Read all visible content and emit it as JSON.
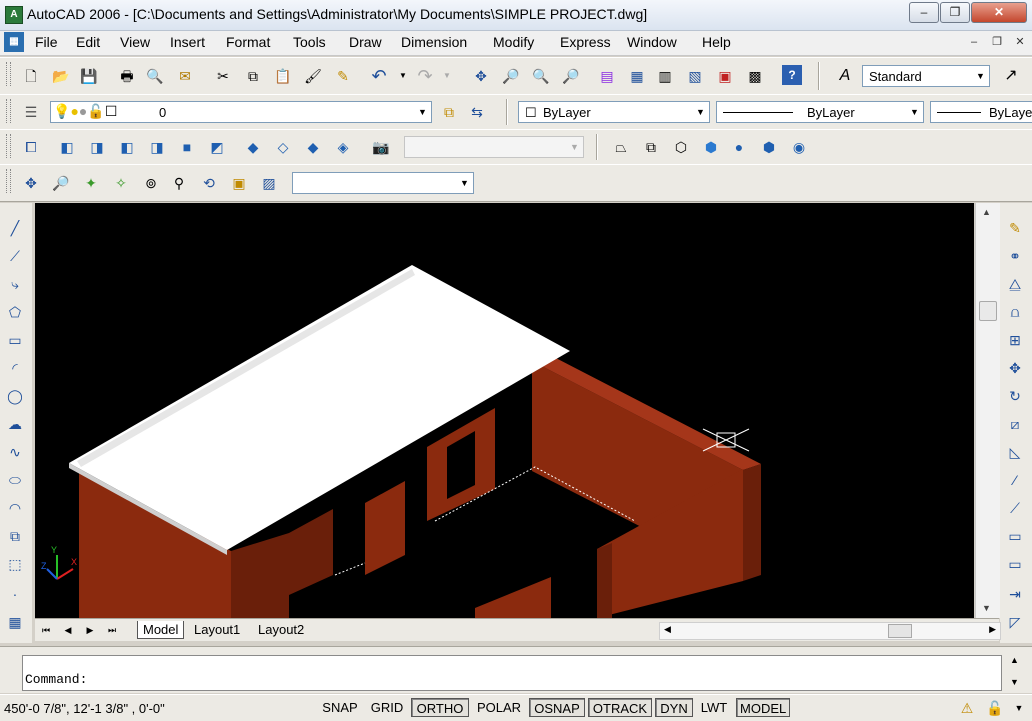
{
  "window": {
    "app_icon": "A",
    "title": "AutoCAD 2006 - [C:\\Documents and Settings\\Administrator\\My Documents\\SIMPLE PROJECT.dwg]",
    "minimize": "–",
    "restore": "❐",
    "close": "✕"
  },
  "menu": {
    "items": [
      "File",
      "Edit",
      "View",
      "Insert",
      "Format",
      "Tools",
      "Draw",
      "Dimension",
      "Modify",
      "Express",
      "Window",
      "Help"
    ],
    "doc_minimize": "–",
    "doc_restore": "❐",
    "doc_close": "✕"
  },
  "toolbars": {
    "text_style": "Standard",
    "layer": "0",
    "color": "ByLayer",
    "linetype": "ByLayer",
    "lineweight": "ByLayer",
    "shade_combo": "",
    "view_combo": ""
  },
  "layout_tabs": [
    "Model",
    "Layout1",
    "Layout2"
  ],
  "command": {
    "prompt": "Command:"
  },
  "status": {
    "coordinates": "450'-0 7/8\",  12'-1 3/8\" , 0'-0\"",
    "buttons": [
      {
        "label": "SNAP",
        "on": false
      },
      {
        "label": "GRID",
        "on": false
      },
      {
        "label": "ORTHO",
        "on": true
      },
      {
        "label": "POLAR",
        "on": false
      },
      {
        "label": "OSNAP",
        "on": true
      },
      {
        "label": "OTRACK",
        "on": true
      },
      {
        "label": "DYN",
        "on": true
      },
      {
        "label": "LWT",
        "on": false
      },
      {
        "label": "MODEL",
        "on": true
      }
    ]
  },
  "colors": {
    "canvas_bg": "#000000",
    "wall": "#8b2a0e",
    "wall_dark": "#6a1f0a",
    "roof": "#ffffff"
  }
}
